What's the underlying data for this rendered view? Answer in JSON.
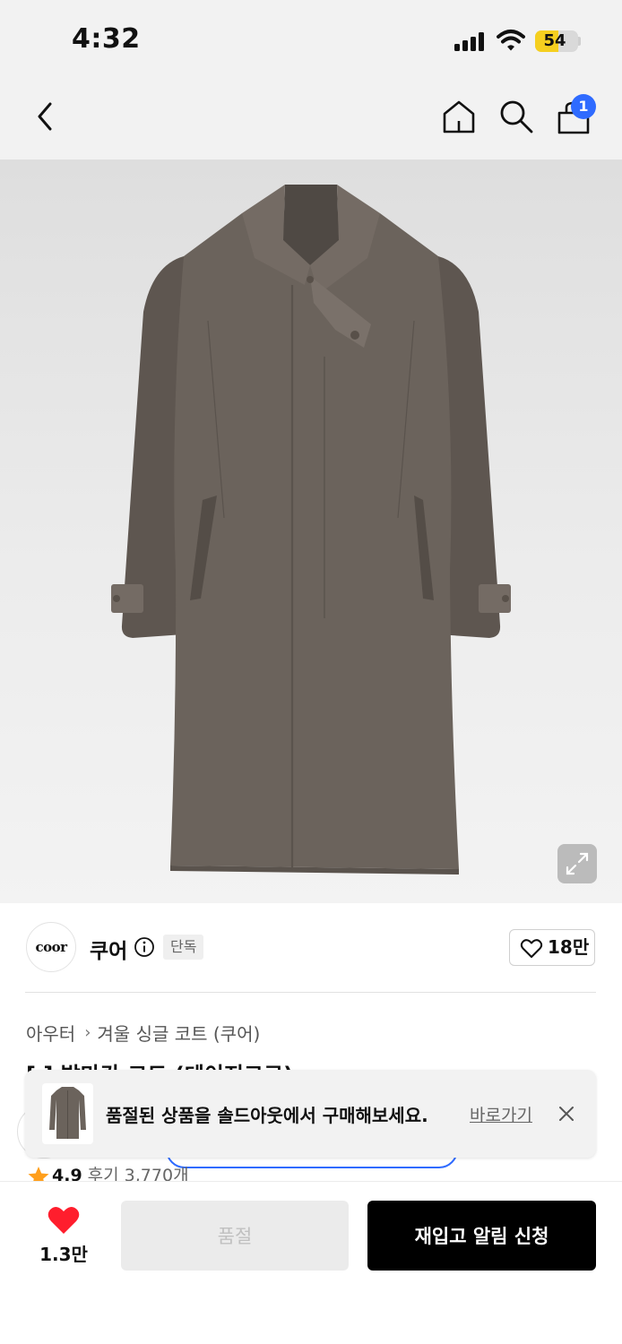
{
  "status_bar": {
    "time": "4:32",
    "battery": "54",
    "battery_level": 0.54
  },
  "nav": {
    "cart_count": "1"
  },
  "brand": {
    "logo_text": "coor",
    "name": "쿠어",
    "exclusive_label": "단독",
    "like_count": "18만"
  },
  "breadcrumb": {
    "category": "아우터",
    "subcategory": "겨울 싱글 코트 (쿠어)"
  },
  "product": {
    "title_partial": "[ ] 발마칸 코트 (데이지그로)"
  },
  "toast": {
    "message": "품절된 상품을 솔드아웃에서 구매해보세요.",
    "link": "바로가기"
  },
  "rating": {
    "score": "4.9",
    "reviews": "후기 3,770개"
  },
  "bottom_bar": {
    "wish_count": "1.3만",
    "soldout_label": "품절",
    "restock_label": "재입고 알림 신청"
  },
  "colors": {
    "accent": "#2f6bff",
    "wish_red": "#ff1e2d",
    "rating_star": "#ff9f1c",
    "coat": "#6b635c"
  }
}
